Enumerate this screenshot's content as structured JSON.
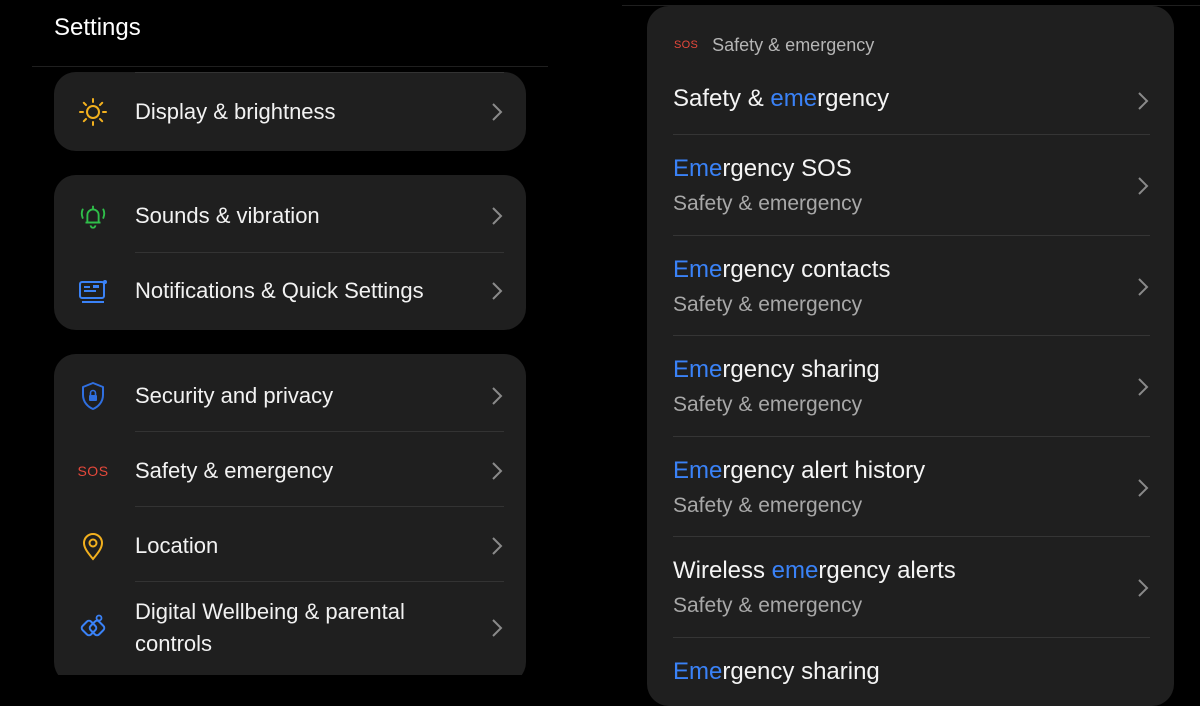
{
  "left": {
    "title": "Settings",
    "cards": [
      {
        "items": [
          {
            "icon": "sun-icon",
            "label": "Display & brightness"
          }
        ]
      },
      {
        "items": [
          {
            "icon": "bell-ringing-icon",
            "label": "Sounds & vibration"
          },
          {
            "icon": "notification-panel-icon",
            "label": "Notifications & Quick Settings"
          }
        ]
      },
      {
        "items": [
          {
            "icon": "shield-lock-icon",
            "label": "Security and privacy"
          },
          {
            "icon": "sos-icon",
            "icon_text": "SOS",
            "label": "Safety & emergency"
          },
          {
            "icon": "location-pin-icon",
            "label": "Location"
          },
          {
            "icon": "wellbeing-icon",
            "label": "Digital Wellbeing & parental controls"
          }
        ]
      }
    ]
  },
  "right": {
    "header": {
      "icon_text": "SOS",
      "label": "Safety & emergency"
    },
    "results": [
      {
        "pre": "Safety & ",
        "match": "eme",
        "post": "rgency",
        "sub": ""
      },
      {
        "pre": "",
        "match": "Eme",
        "post": "rgency SOS",
        "sub": "Safety & emergency"
      },
      {
        "pre": "",
        "match": "Eme",
        "post": "rgency contacts",
        "sub": "Safety & emergency"
      },
      {
        "pre": "",
        "match": "Eme",
        "post": "rgency sharing",
        "sub": "Safety & emergency"
      },
      {
        "pre": "",
        "match": "Eme",
        "post": "rgency alert history",
        "sub": "Safety & emergency"
      },
      {
        "pre": "Wireless ",
        "match": "eme",
        "post": "rgency alerts",
        "sub": "Safety & emergency"
      },
      {
        "pre": "",
        "match": "Eme",
        "post": "rgency sharing",
        "sub": ""
      }
    ]
  },
  "colors": {
    "highlight": "#3a82f7",
    "sos": "#e5483b",
    "sun": "#f2b01e",
    "bell": "#2fbf4a",
    "notification": "#3a82f7",
    "shield": "#2f6fe0",
    "location": "#f2b01e",
    "wellbeing": "#3a82f7"
  }
}
